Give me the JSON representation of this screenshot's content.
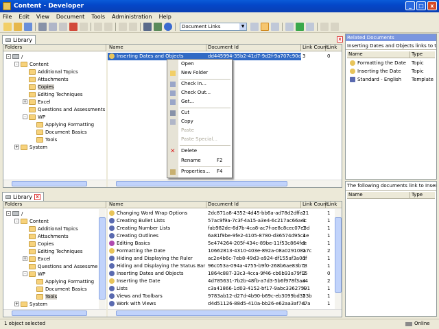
{
  "window": {
    "title": "Content - Developer",
    "controls": [
      "_",
      "□",
      "x"
    ]
  },
  "menu": [
    "File",
    "Edit",
    "View",
    "Document",
    "Tools",
    "Administration",
    "Help"
  ],
  "toolbar": {
    "combo_value": "Document Links"
  },
  "top_library": {
    "tab": "Library",
    "folders_header": "Folders",
    "cols": [
      "Name",
      "Document Id",
      "Link Count",
      "Link"
    ],
    "tree": [
      "/",
      "Content",
      "Additional Topics",
      "Attachments",
      "Copies",
      "Editing Techniques",
      "Excel",
      "Questions and Assessments",
      "WP",
      "Applying Formatting",
      "Document Basics",
      "Tools",
      "System"
    ],
    "selected_row": {
      "name": "Inserting Dates and Objects",
      "id": "dd445994-35b2-41d7-9d2f-9a707c90d696",
      "count": "3",
      "link": "0"
    }
  },
  "context_menu": {
    "items": [
      {
        "label": "Open",
        "shortcut": "",
        "disabled": false,
        "icon": ""
      },
      {
        "label": "New Folder",
        "shortcut": "",
        "disabled": false,
        "icon": "folder-icon"
      },
      {
        "label": "Check In...",
        "shortcut": "",
        "disabled": false,
        "icon": "check-in-icon"
      },
      {
        "label": "Check Out...",
        "shortcut": "",
        "disabled": false,
        "icon": "check-out-icon"
      },
      {
        "label": "Get...",
        "shortcut": "",
        "disabled": false,
        "icon": "get-icon"
      },
      {
        "label": "Cut",
        "shortcut": "",
        "disabled": false,
        "icon": "cut-icon"
      },
      {
        "label": "Copy",
        "shortcut": "",
        "disabled": false,
        "icon": "copy-icon"
      },
      {
        "label": "Paste",
        "shortcut": "",
        "disabled": true,
        "icon": ""
      },
      {
        "label": "Paste Special...",
        "shortcut": "",
        "disabled": true,
        "icon": ""
      },
      {
        "label": "Delete",
        "shortcut": "",
        "disabled": false,
        "icon": "delete-icon"
      },
      {
        "label": "Rename",
        "shortcut": "F2",
        "disabled": false,
        "icon": ""
      },
      {
        "label": "Properties...",
        "shortcut": "F4",
        "disabled": false,
        "icon": "properties-icon"
      }
    ]
  },
  "related": {
    "title": "Related Documents",
    "subtitle": "Inserting Dates and Objects links to the...",
    "cols": [
      "Name",
      "Type"
    ],
    "rows": [
      {
        "name": "Formatting the Date",
        "type": "Topic"
      },
      {
        "name": "Inserting the Date",
        "type": "Topic"
      },
      {
        "name": "Standard - English",
        "type": "Template"
      }
    ],
    "subtitle2": "The following documents link to Insertin...",
    "cols2": [
      "Name",
      "Type"
    ]
  },
  "bottom_library": {
    "tab": "Library",
    "folders_header": "Folders",
    "cols": [
      "Name",
      "Document Id",
      "Link Count",
      "Link"
    ],
    "tree": [
      "/",
      "Content",
      "Additional Topics",
      "Attachments",
      "Copies",
      "Editing Techniques",
      "Excel",
      "Questions and Assessments",
      "WP",
      "Applying Formatting",
      "Document Basics",
      "Tools",
      "System"
    ],
    "rows": [
      {
        "name": "Changing Word Wrap Options",
        "id": "2dc871a8-4352-4d45-bb6a-ad78d2dffa21",
        "count": "1",
        "link": "1"
      },
      {
        "name": "Creating Bullet Lists",
        "id": "57ac9f9a-7c3f-4a15-a3e4-6c217ac66aec",
        "count": "1",
        "link": "1"
      },
      {
        "name": "Creating Number Lists",
        "id": "fab982de-6d7b-4ca8-ac7f-ae8c8cec07e3d",
        "count": "1",
        "link": "1"
      },
      {
        "name": "Creating Outlines",
        "id": "6a81f9be-9fe2-4105-8780-d36574d95c4e",
        "count": "1",
        "link": "1"
      },
      {
        "name": "Editing Basics",
        "id": "5e474264-205f-434c-89be-11f53c864fce",
        "count": "6",
        "link": "1"
      },
      {
        "name": "Formatting the Date",
        "id": "10662813-4310-403e-892a-08a029108a7c",
        "count": "1",
        "link": "2"
      },
      {
        "name": "Hiding and Displaying the Ruler",
        "id": "ac2e4b6c-7eb8-49d3-a924-df155af3a0df",
        "count": "1",
        "link": "1"
      },
      {
        "name": "Hiding and Displaying the Status Bar",
        "id": "96c053a-094a-4755-b9f0-268b6ae83b73",
        "count": "1",
        "link": "1"
      },
      {
        "name": "Inserting Dates and Objects",
        "id": "1864c887-33c3-4cca-9f46-cb6b93a79f15",
        "count": "3",
        "link": "0"
      },
      {
        "name": "Inserting the Date",
        "id": "4d785631-7b2b-48fb-a7d3-5b6f978f3aa4",
        "count": "4",
        "link": "2"
      },
      {
        "name": "Lists",
        "id": "c3a41866-1d03-4152-bf17-9abc33627591",
        "count": "4",
        "link": "1"
      },
      {
        "name": "Views and Toolbars",
        "id": "9783ab12-d27d-4b90-b69c-eb3099bd353b",
        "count": "2",
        "link": "1"
      },
      {
        "name": "Work with Views",
        "id": "d4d51126-88d5-410a-bb26-e62aa3af7e7a",
        "count": "1",
        "link": "1"
      }
    ]
  },
  "status": {
    "left": "1 object selected",
    "right": "Online"
  }
}
